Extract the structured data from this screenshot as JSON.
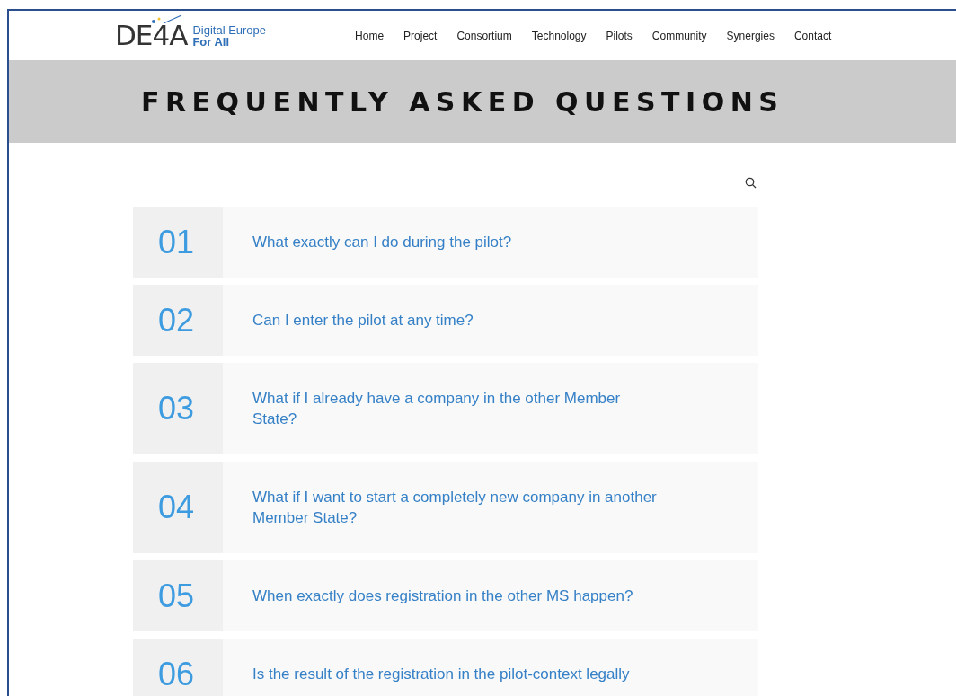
{
  "logo": {
    "wordmark": "DE4A",
    "tagline": [
      "Digital Europe",
      "For All"
    ]
  },
  "nav": [
    "Home",
    "Project",
    "Consortium",
    "Technology",
    "Pilots",
    "Community",
    "Synergies",
    "Contact"
  ],
  "banner": {
    "title": "FREQUENTLY ASKED QUESTIONS"
  },
  "faqs": [
    {
      "number": "01",
      "question": "What exactly can I do during the pilot?"
    },
    {
      "number": "02",
      "question": "Can I enter the pilot at any time?"
    },
    {
      "number": "03",
      "question": "What if I already have a company in the other Member State?"
    },
    {
      "number": "04",
      "question": "What if I want to start a completely new company in another Member State?"
    },
    {
      "number": "05",
      "question": "When exactly does registration in the other MS happen?"
    },
    {
      "number": "06",
      "question": "Is the result of the registration in the pilot-context legally"
    }
  ]
}
